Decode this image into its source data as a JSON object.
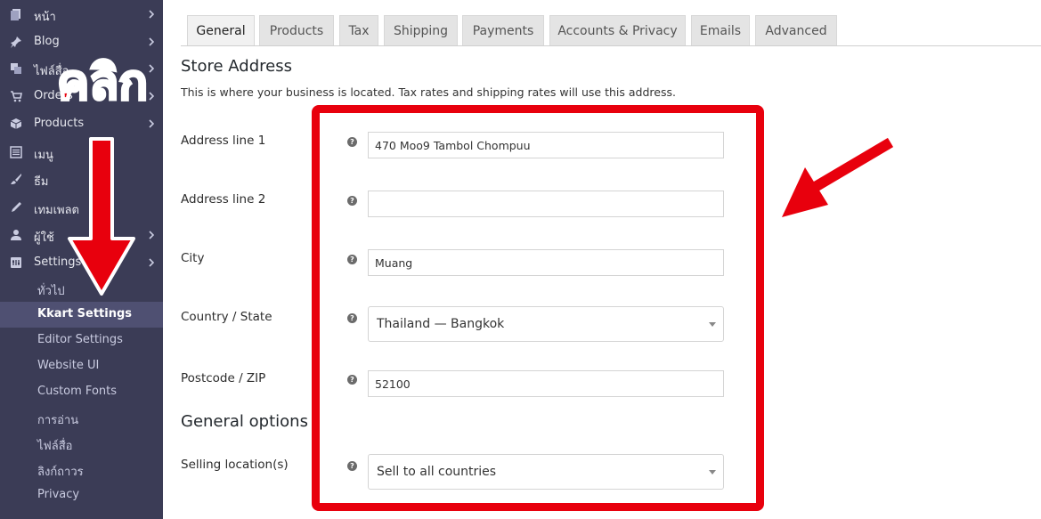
{
  "sidebar": {
    "menu": [
      {
        "label": "หน้า",
        "icon": "pages-icon",
        "chevron": true
      },
      {
        "label": "Blog",
        "icon": "pin-icon",
        "chevron": true
      },
      {
        "label": "ไฟล์สื่อ",
        "icon": "media-icon",
        "chevron": true
      },
      {
        "label": "Orders",
        "icon": "cart-icon",
        "chevron": true
      },
      {
        "label": "Products",
        "icon": "box-icon",
        "chevron": true
      },
      {
        "label": "เมนู",
        "icon": "list-icon",
        "chevron": false
      },
      {
        "label": "ธีม",
        "icon": "brush-icon",
        "chevron": false
      },
      {
        "label": "เทมเพลต",
        "icon": "pencil-icon",
        "chevron": false
      },
      {
        "label": "ผู้ใช้",
        "icon": "user-icon",
        "chevron": true
      },
      {
        "label": "Settings",
        "icon": "settings-icon",
        "chevron": true
      }
    ],
    "submenu": [
      {
        "label": "ทั่วไป",
        "active": false
      },
      {
        "label": "Kkart Settings",
        "active": true
      },
      {
        "label": "Editor Settings",
        "active": false
      },
      {
        "label": "Website UI",
        "active": false
      },
      {
        "label": "Custom Fonts",
        "active": false
      },
      {
        "label": "การอ่าน",
        "active": false
      },
      {
        "label": "ไฟล์สื่อ",
        "active": false
      },
      {
        "label": "ลิงก์ถาวร",
        "active": false
      },
      {
        "label": "Privacy",
        "active": false
      }
    ]
  },
  "tabs": [
    {
      "label": "General",
      "active": true
    },
    {
      "label": "Products",
      "active": false
    },
    {
      "label": "Tax",
      "active": false
    },
    {
      "label": "Shipping",
      "active": false
    },
    {
      "label": "Payments",
      "active": false
    },
    {
      "label": "Accounts & Privacy",
      "active": false
    },
    {
      "label": "Emails",
      "active": false
    },
    {
      "label": "Advanced",
      "active": false
    }
  ],
  "store_address": {
    "heading": "Store Address",
    "description": "This is where your business is located. Tax rates and shipping rates will use this address.",
    "fields": {
      "address1": {
        "label": "Address line 1",
        "value": "470 Moo9 Tambol Chompuu"
      },
      "address2": {
        "label": "Address line 2",
        "value": ""
      },
      "city": {
        "label": "City",
        "value": "Muang"
      },
      "country": {
        "label": "Country / State",
        "value": "Thailand — Bangkok"
      },
      "postcode": {
        "label": "Postcode / ZIP",
        "value": "52100"
      }
    }
  },
  "general_options": {
    "heading": "General options",
    "selling_location": {
      "label": "Selling location(s)",
      "value": "Sell to all countries"
    }
  },
  "annotation": {
    "click_text": "คลิก",
    "color": "#e8000d"
  },
  "colors": {
    "sidebar_bg": "#3b3c56",
    "sidebar_active_bg": "#4f5072"
  },
  "help_glyph": "?"
}
